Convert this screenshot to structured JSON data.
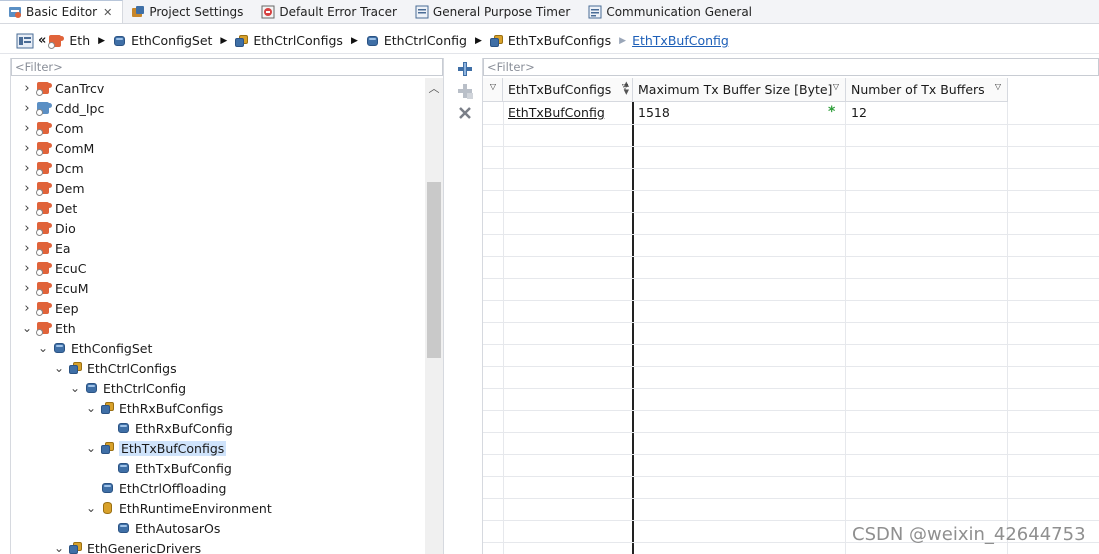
{
  "tabs": [
    {
      "label": "Basic Editor",
      "icon": "basic-editor-icon",
      "active": true,
      "closable": true
    },
    {
      "label": "Project Settings",
      "icon": "project-settings-icon"
    },
    {
      "label": "Default Error Tracer",
      "icon": "error-tracer-icon"
    },
    {
      "label": "General Purpose Timer",
      "icon": "timer-icon"
    },
    {
      "label": "Communication General",
      "icon": "communication-icon"
    }
  ],
  "breadcrumb": {
    "items": [
      "Eth",
      "EthConfigSet",
      "EthCtrlConfigs",
      "EthCtrlConfig",
      "EthTxBufConfigs"
    ],
    "current": "EthTxBufConfig"
  },
  "tree": {
    "filter_placeholder": "<Filter>",
    "items": [
      {
        "label": "CanTrcv",
        "level": 0,
        "expanded": false,
        "icon": "module"
      },
      {
        "label": "Cdd_Ipc",
        "level": 0,
        "expanded": false,
        "icon": "module-blue"
      },
      {
        "label": "Com",
        "level": 0,
        "expanded": false,
        "icon": "module"
      },
      {
        "label": "ComM",
        "level": 0,
        "expanded": false,
        "icon": "module"
      },
      {
        "label": "Dcm",
        "level": 0,
        "expanded": false,
        "icon": "module"
      },
      {
        "label": "Dem",
        "level": 0,
        "expanded": false,
        "icon": "module"
      },
      {
        "label": "Det",
        "level": 0,
        "expanded": false,
        "icon": "module"
      },
      {
        "label": "Dio",
        "level": 0,
        "expanded": false,
        "icon": "module"
      },
      {
        "label": "Ea",
        "level": 0,
        "expanded": false,
        "icon": "module"
      },
      {
        "label": "EcuC",
        "level": 0,
        "expanded": false,
        "icon": "module"
      },
      {
        "label": "EcuM",
        "level": 0,
        "expanded": false,
        "icon": "module"
      },
      {
        "label": "Eep",
        "level": 0,
        "expanded": false,
        "icon": "module"
      },
      {
        "label": "Eth",
        "level": 0,
        "expanded": true,
        "icon": "module"
      },
      {
        "label": "EthConfigSet",
        "level": 1,
        "expanded": true,
        "icon": "container"
      },
      {
        "label": "EthCtrlConfigs",
        "level": 2,
        "expanded": true,
        "icon": "multi-container"
      },
      {
        "label": "EthCtrlConfig",
        "level": 3,
        "expanded": true,
        "icon": "container"
      },
      {
        "label": "EthRxBufConfigs",
        "level": 4,
        "expanded": true,
        "icon": "multi-container"
      },
      {
        "label": "EthRxBufConfig",
        "level": 5,
        "icon": "container"
      },
      {
        "label": "EthTxBufConfigs",
        "level": 4,
        "expanded": true,
        "icon": "multi-container",
        "selected": true
      },
      {
        "label": "EthTxBufConfig",
        "level": 5,
        "icon": "container"
      },
      {
        "label": "EthCtrlOffloading",
        "level": 4,
        "icon": "container"
      },
      {
        "label": "EthRuntimeEnvironment",
        "level": 4,
        "expanded": true,
        "icon": "cylinder"
      },
      {
        "label": "EthAutosarOs",
        "level": 5,
        "icon": "container"
      },
      {
        "label": "EthGenericDrivers",
        "level": 2,
        "expanded": true,
        "icon": "multi-container"
      }
    ]
  },
  "toolbar": {
    "add": "add-icon",
    "add_disabled": "add-multi-icon",
    "delete": "delete-icon"
  },
  "table": {
    "filter_placeholder": "<Filter>",
    "columns": [
      "EthTxBufConfigs",
      "Maximum Tx Buffer Size [Byte]",
      "Number of Tx Buffers"
    ],
    "rows": [
      {
        "name": "EthTxBufConfig",
        "max_size": "1518",
        "count": "12"
      }
    ],
    "modified_marker": "*"
  },
  "watermark": "CSDN @weixin_42644753",
  "colors": {
    "accent": "#1d5fb8",
    "selection": "#cfe3fb",
    "module": "#e0633a",
    "container": "#3f6fa6"
  }
}
